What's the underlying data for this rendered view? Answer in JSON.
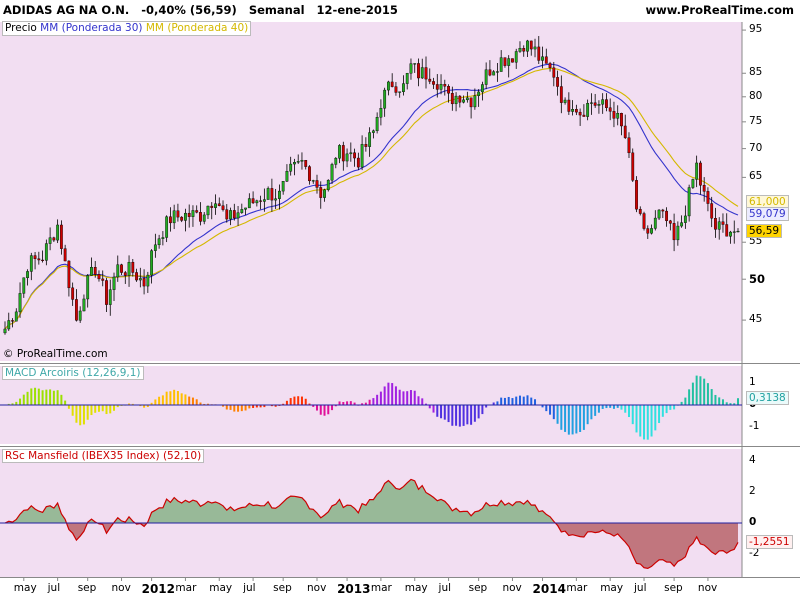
{
  "header": {
    "name": "ADIDAS AG NA O.N.",
    "change": "-0,40% (56,59)",
    "period": "Semanal",
    "date": "12-ene-2015",
    "site": "www.ProRealTime.com"
  },
  "watermark": "© ProRealTime.com",
  "price_panel": {
    "legend": [
      {
        "text": "Precio",
        "color": "#000000"
      },
      {
        "text": "MM (Ponderada 30)",
        "color": "#3333cc"
      },
      {
        "text": "MM (Ponderada 40)",
        "color": "#d4b800"
      }
    ],
    "ticks": [
      {
        "v": 95,
        "t": "95"
      },
      {
        "v": 85,
        "t": "85"
      },
      {
        "v": 80,
        "t": "80"
      },
      {
        "v": 75,
        "t": "75"
      },
      {
        "v": 70,
        "t": "70"
      },
      {
        "v": 65,
        "t": "65"
      },
      {
        "v": 55,
        "t": "55"
      },
      {
        "v": 50,
        "t": "50"
      },
      {
        "v": 45,
        "t": "45"
      }
    ],
    "value_labels": [
      {
        "v": 61.0,
        "t": "61,000",
        "color": "#d4b800",
        "bg": "#fff8d8"
      },
      {
        "v": 59.079,
        "t": "59,079",
        "color": "#3333cc",
        "bg": "#ececff"
      },
      {
        "v": 56.59,
        "t": "56,59",
        "color": "#000000",
        "bg": "#ffd400"
      }
    ]
  },
  "macd_panel": {
    "legend": "MACD Arcoiris (12,26,9,1)",
    "ticks": [
      {
        "v": 1,
        "t": "1"
      },
      {
        "v": 0,
        "t": "0"
      },
      {
        "v": -1,
        "t": "-1"
      }
    ],
    "value_label": {
      "v": 0.3138,
      "t": "0,3138",
      "color": "#20a0a0"
    }
  },
  "rsc_panel": {
    "legend": "RSc Mansfield (IBEX35 Index) (52,10)",
    "ticks": [
      {
        "v": 4,
        "t": "4"
      },
      {
        "v": 2,
        "t": "2"
      },
      {
        "v": 0,
        "t": "0"
      },
      {
        "v": -2,
        "t": "-2"
      }
    ],
    "value_label": {
      "v": -1.2551,
      "t": "-1,2551",
      "color": "#cc0000"
    }
  },
  "x_axis": [
    {
      "i": 5,
      "t": "may",
      "bold": false
    },
    {
      "i": 14,
      "t": "jul",
      "bold": false
    },
    {
      "i": 22,
      "t": "sep",
      "bold": false
    },
    {
      "i": 31,
      "t": "nov",
      "bold": false
    },
    {
      "i": 39,
      "t": "2012",
      "bold": true
    },
    {
      "i": 48,
      "t": "mar",
      "bold": false
    },
    {
      "i": 57,
      "t": "may",
      "bold": false
    },
    {
      "i": 66,
      "t": "jul",
      "bold": false
    },
    {
      "i": 74,
      "t": "sep",
      "bold": false
    },
    {
      "i": 83,
      "t": "nov",
      "bold": false
    },
    {
      "i": 91,
      "t": "2013",
      "bold": true
    },
    {
      "i": 100,
      "t": "mar",
      "bold": false
    },
    {
      "i": 109,
      "t": "may",
      "bold": false
    },
    {
      "i": 118,
      "t": "jul",
      "bold": false
    },
    {
      "i": 126,
      "t": "sep",
      "bold": false
    },
    {
      "i": 135,
      "t": "nov",
      "bold": false
    },
    {
      "i": 143,
      "t": "2014",
      "bold": true
    },
    {
      "i": 152,
      "t": "mar",
      "bold": false
    },
    {
      "i": 161,
      "t": "may",
      "bold": false
    },
    {
      "i": 170,
      "t": "jul",
      "bold": false
    },
    {
      "i": 178,
      "t": "sep",
      "bold": false
    },
    {
      "i": 187,
      "t": "nov",
      "bold": false
    }
  ],
  "chart_data": {
    "type": "candlestick",
    "title": "ADIDAS AG NA O.N.",
    "x_unit": "weeks (apr 2011 - ene 2015)",
    "y_scale": "log",
    "y_range": [
      40.5,
      97
    ],
    "weeks": 196,
    "close_anchors": [
      [
        0,
        44
      ],
      [
        3,
        46.5
      ],
      [
        6,
        52
      ],
      [
        10,
        53
      ],
      [
        14,
        57.5
      ],
      [
        16,
        52
      ],
      [
        19,
        45
      ],
      [
        21,
        48.5
      ],
      [
        24,
        51.5
      ],
      [
        27,
        47.5
      ],
      [
        30,
        51.5
      ],
      [
        34,
        51
      ],
      [
        37,
        49.5
      ],
      [
        40,
        55
      ],
      [
        44,
        58.5
      ],
      [
        48,
        59
      ],
      [
        52,
        59
      ],
      [
        56,
        62
      ],
      [
        59,
        58
      ],
      [
        62,
        59.5
      ],
      [
        66,
        61
      ],
      [
        70,
        62.5
      ],
      [
        73,
        62
      ],
      [
        76,
        66
      ],
      [
        79,
        67.5
      ],
      [
        82,
        65
      ],
      [
        84,
        62.5
      ],
      [
        86,
        64
      ],
      [
        88,
        69
      ],
      [
        91,
        69.5
      ],
      [
        94,
        68
      ],
      [
        96,
        70.5
      ],
      [
        98,
        73
      ],
      [
        100,
        79
      ],
      [
        103,
        83
      ],
      [
        106,
        82
      ],
      [
        108,
        86.5
      ],
      [
        110,
        85
      ],
      [
        113,
        85
      ],
      [
        116,
        82.5
      ],
      [
        118,
        79.5
      ],
      [
        121,
        80.5
      ],
      [
        124,
        79.5
      ],
      [
        126,
        82
      ],
      [
        129,
        86
      ],
      [
        132,
        88
      ],
      [
        135,
        89
      ],
      [
        138,
        92
      ],
      [
        141,
        90
      ],
      [
        143,
        87
      ],
      [
        146,
        85
      ],
      [
        149,
        78
      ],
      [
        151,
        79
      ],
      [
        153,
        77
      ],
      [
        156,
        79
      ],
      [
        159,
        78
      ],
      [
        162,
        77
      ],
      [
        165,
        72
      ],
      [
        168,
        60
      ],
      [
        170,
        56
      ],
      [
        172,
        57
      ],
      [
        174,
        59
      ],
      [
        176,
        58
      ],
      [
        178,
        55
      ],
      [
        180,
        58
      ],
      [
        182,
        62
      ],
      [
        184,
        67
      ],
      [
        185,
        64
      ],
      [
        187,
        60
      ],
      [
        189,
        57
      ],
      [
        192,
        57
      ],
      [
        194,
        56.59
      ]
    ],
    "series": [
      {
        "name": "MM (Ponderada 30)",
        "role": "weighted moving average"
      },
      {
        "name": "MM (Ponderada 40)",
        "role": "weighted moving average"
      }
    ],
    "indicators": [
      {
        "name": "MACD Arcoiris (12,26,9,1)",
        "y_range": [
          -1.8,
          1.8
        ],
        "last": 0.3138
      },
      {
        "name": "RSc Mansfield (IBEX35 Index) (52,10)",
        "y_range": [
          -3.5,
          4.8
        ],
        "last": -1.2551
      }
    ]
  },
  "colors": {
    "panel_bg": "#f2def2",
    "up": "#22aa22",
    "down": "#cc0000",
    "wma30": "#3333cc",
    "wma40": "#d4b800",
    "rsc_pos_fill": "#4f9a4f",
    "rsc_neg_fill": "#a03030"
  }
}
